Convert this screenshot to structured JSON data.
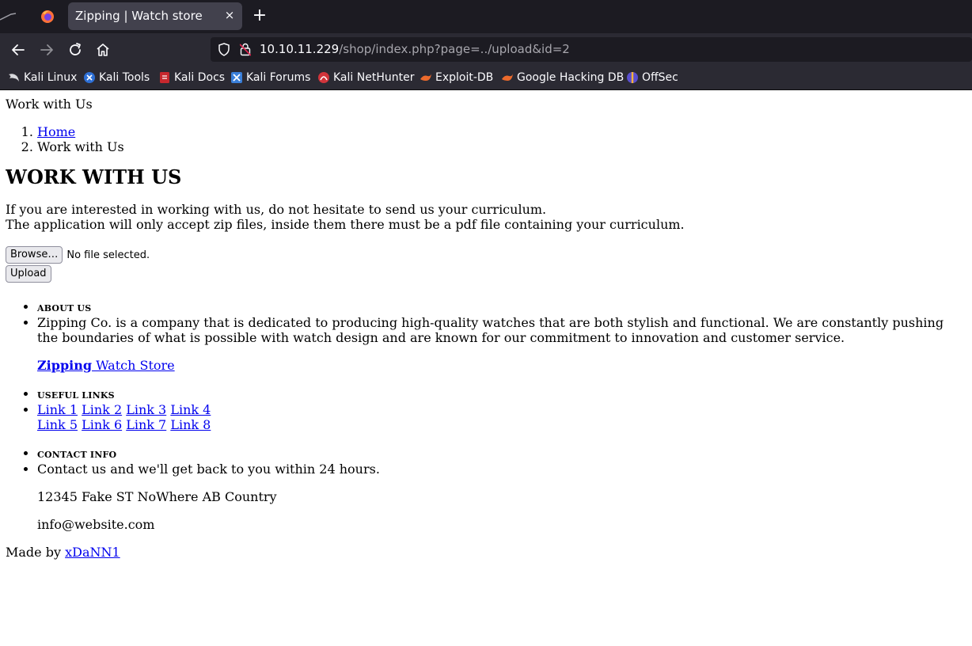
{
  "browser": {
    "tab_title": "Zipping | Watch store",
    "tab_close": "×",
    "new_tab": "+",
    "url_host": "10.10.11.229",
    "url_path": "/shop/index.php?page=../upload&id=2"
  },
  "bookmarks": [
    {
      "label": "Kali Linux",
      "icon": "kali-dragon-icon"
    },
    {
      "label": "Kali Tools",
      "icon": "kali-tools-icon"
    },
    {
      "label": "Kali Docs",
      "icon": "kali-docs-icon"
    },
    {
      "label": "Kali Forums",
      "icon": "kali-forums-icon"
    },
    {
      "label": "Kali NetHunter",
      "icon": "kali-nethunter-icon"
    },
    {
      "label": "Exploit-DB",
      "icon": "exploit-db-icon"
    },
    {
      "label": "Google Hacking DB",
      "icon": "google-hacking-db-icon"
    },
    {
      "label": "OffSec",
      "icon": "offsec-icon"
    }
  ],
  "page": {
    "label": "Work with Us",
    "breadcrumbs": [
      {
        "label": "Home"
      },
      {
        "label": "Work with Us"
      }
    ],
    "title": "WORK WITH US",
    "intro_line1": "If you are interested in working with us, do not hesitate to send us your curriculum.",
    "intro_line2": "The application will only accept zip files, inside them there must be a pdf file containing your curriculum.",
    "browse_label": "Browse…",
    "file_status": "No file selected.",
    "upload_label": "Upload"
  },
  "footer": {
    "about_heading": "ABOUT US",
    "about_text": "Zipping Co. is a company that is dedicated to producing high-quality watches that are both stylish and functional. We are constantly pushing the boundaries of what is possible with watch design and are known for our commitment to innovation and customer service.",
    "brand_bold": "Zipping",
    "brand_rest": " Watch Store",
    "links_heading": "USEFUL LINKS",
    "links": [
      "Link 1",
      "Link 2",
      "Link 3",
      "Link 4",
      "Link 5",
      "Link 6",
      "Link 7",
      "Link 8"
    ],
    "contact_heading": "CONTACT INFO",
    "contact_text": "Contact us and we'll get back to you within 24 hours.",
    "address": "12345 Fake ST NoWhere AB Country",
    "email": "info@website.com",
    "made_by": "Made by ",
    "author": "xDaNN1"
  }
}
